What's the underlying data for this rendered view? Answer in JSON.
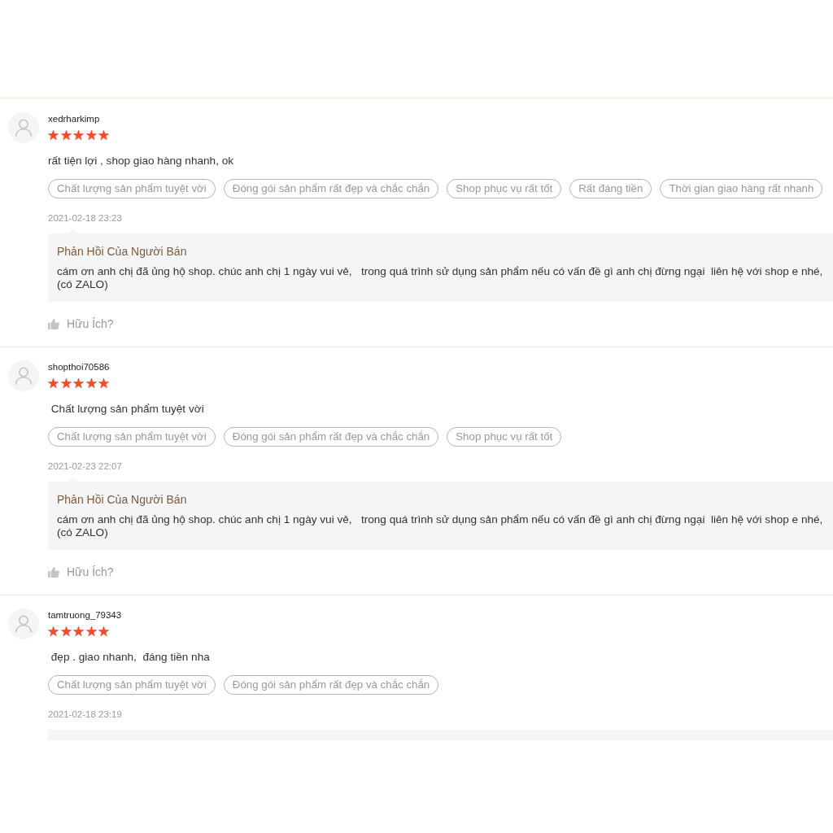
{
  "reviews": [
    {
      "username": "xedrharkimp",
      "stars": 5,
      "comment": "rất tiện lợi , shop giao hàng nhanh, ok",
      "tags": [
        "Chất lượng sản phẩm tuyệt vời",
        "Đóng gói sản phẩm rất đẹp và chắc chắn",
        "Shop phục vụ rất tốt",
        "Rất đáng tiền",
        "Thời gian giao hàng rất nhanh"
      ],
      "date": "2021-02-18 23:23",
      "reply": {
        "cut_off": false,
        "title": "Phản Hồi Của Người Bán",
        "text": "cám ơn anh chị đã ủng hộ shop. chúc anh chị 1 ngày vui vẻ,   trong quá trình sử dụng sản phẩm nếu có vấn đề gì anh chị đừng ngại  liên hệ với shop e nhé,\n(có ZALO)"
      },
      "helpful_label": "Hữu Ích?"
    },
    {
      "username": "shopthoi70586",
      "stars": 5,
      "comment": " Chất lượng sản phẩm tuyệt vời",
      "tags": [
        "Chất lượng sản phẩm tuyệt vời",
        "Đóng gói sản phẩm rất đẹp và chắc chắn",
        "Shop phục vụ rất tốt"
      ],
      "date": "2021-02-23 22:07",
      "reply": {
        "cut_off": false,
        "title": "Phản Hồi Của Người Bán",
        "text": "cám ơn anh chị đã ủng hộ shop. chúc anh chị 1 ngày vui vẻ,   trong quá trình sử dụng sản phẩm nếu có vấn đề gì anh chị đừng ngại  liên hệ với shop e nhé,\n(có ZALO)"
      },
      "helpful_label": "Hữu Ích?"
    },
    {
      "username": "tamtruong_79343",
      "stars": 5,
      "comment": " đẹp . giao nhanh,  đáng tiền nha",
      "tags": [
        "Chất lượng sản phẩm tuyệt vời",
        "Đóng gói sản phẩm rất đẹp và chắc chắn"
      ],
      "date": "2021-02-18 23:19",
      "reply": {
        "cut_off": true
      }
    }
  ]
}
